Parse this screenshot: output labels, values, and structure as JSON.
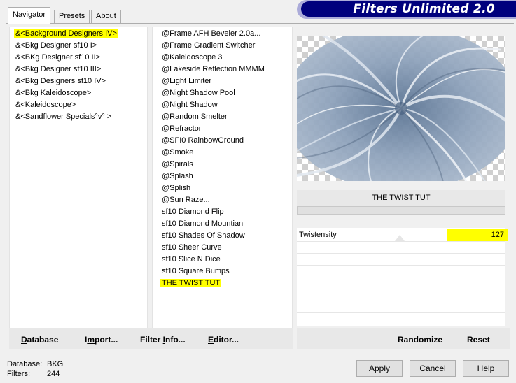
{
  "tabs": [
    {
      "label": "Navigator",
      "active": true
    },
    {
      "label": "Presets",
      "active": false
    },
    {
      "label": "About",
      "active": false
    }
  ],
  "banner": {
    "title": "Filters Unlimited 2.0"
  },
  "categories": [
    "&<Background Designers IV>",
    "&<Bkg Designer sf10 I>",
    "&<BKg Designer sf10 II>",
    "&<Bkg Designer sf10 III>",
    "&<Bkg Designers sf10 IV>",
    "&<Bkg Kaleidoscope>",
    "&<Kaleidoscope>",
    "&<Sandflower Specials°v° >"
  ],
  "selected_category_index": 0,
  "filters": [
    "@Frame AFH Beveler 2.0a...",
    "@Frame Gradient Switcher",
    "@Kaleidoscope 3",
    "@Lakeside Reflection MMMM",
    "@Light Limiter",
    "@Night Shadow Pool",
    "@Night Shadow",
    "@Random Smelter",
    "@Refractor",
    "@SFI0 RainbowGround",
    "@Smoke",
    "@Spirals",
    "@Splash",
    "@Splish",
    "@Sun Raze...",
    "sf10 Diamond Flip",
    "sf10 Diamond Mountian",
    "sf10 Shades Of Shadow",
    "sf10 Sheer Curve",
    "sf10 Slice N Dice",
    "sf10 Square Bumps",
    "THE TWIST TUT"
  ],
  "selected_filter_index": 21,
  "left_actions": {
    "database": {
      "underline": "D",
      "rest": "atabase"
    },
    "import": {
      "pre": "I",
      "underline": "m",
      "rest": "port..."
    },
    "filter_info": {
      "pre": "Filter ",
      "underline": "I",
      "rest": "nfo..."
    },
    "editor": {
      "underline": "E",
      "rest": "ditor..."
    }
  },
  "filter_panel": {
    "title": "THE TWIST TUT",
    "param_label": "Twistensity",
    "param_value": "127"
  },
  "right_actions": {
    "randomize": "Randomize",
    "reset": "Reset"
  },
  "status": {
    "database_label": "Database:",
    "database_value": "BKG",
    "filters_label": "Filters:",
    "filters_value": "244"
  },
  "buttons": {
    "apply": "Apply",
    "cancel": "Cancel",
    "help": "Help"
  },
  "colors": {
    "banner": "#00007d",
    "highlight": "#ffff00"
  }
}
